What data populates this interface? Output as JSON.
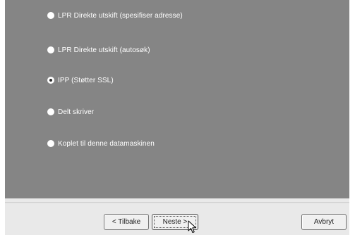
{
  "options": [
    {
      "label": "LPR Direkte utskift (spesifiser adresse)",
      "selected": false
    },
    {
      "label": "LPR Direkte utskift (autosøk)",
      "selected": false
    },
    {
      "label": "IPP (Støtter SSL)",
      "selected": true
    },
    {
      "label": "Delt skriver",
      "selected": false
    },
    {
      "label": "Koplet til denne datamaskinen",
      "selected": false
    }
  ],
  "buttons": {
    "back_label": "< Tilbake",
    "next_label": "Neste >",
    "cancel_label": "Avbryt"
  },
  "colors": {
    "panel_background": "#858585",
    "dialog_background": "#e9e9e9",
    "option_text": "#ffffff"
  },
  "icons": {
    "pointer": "mouse-pointer-icon"
  }
}
